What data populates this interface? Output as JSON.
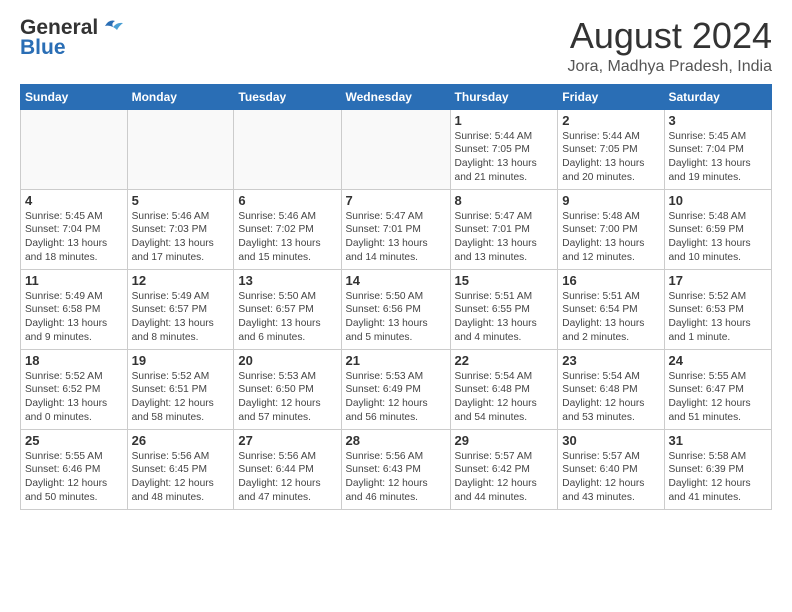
{
  "header": {
    "logo_general": "General",
    "logo_blue": "Blue",
    "month_year": "August 2024",
    "location": "Jora, Madhya Pradesh, India"
  },
  "days_of_week": [
    "Sunday",
    "Monday",
    "Tuesday",
    "Wednesday",
    "Thursday",
    "Friday",
    "Saturday"
  ],
  "weeks": [
    [
      {
        "day": "",
        "info": ""
      },
      {
        "day": "",
        "info": ""
      },
      {
        "day": "",
        "info": ""
      },
      {
        "day": "",
        "info": ""
      },
      {
        "day": "1",
        "info": "Sunrise: 5:44 AM\nSunset: 7:05 PM\nDaylight: 13 hours\nand 21 minutes."
      },
      {
        "day": "2",
        "info": "Sunrise: 5:44 AM\nSunset: 7:05 PM\nDaylight: 13 hours\nand 20 minutes."
      },
      {
        "day": "3",
        "info": "Sunrise: 5:45 AM\nSunset: 7:04 PM\nDaylight: 13 hours\nand 19 minutes."
      }
    ],
    [
      {
        "day": "4",
        "info": "Sunrise: 5:45 AM\nSunset: 7:04 PM\nDaylight: 13 hours\nand 18 minutes."
      },
      {
        "day": "5",
        "info": "Sunrise: 5:46 AM\nSunset: 7:03 PM\nDaylight: 13 hours\nand 17 minutes."
      },
      {
        "day": "6",
        "info": "Sunrise: 5:46 AM\nSunset: 7:02 PM\nDaylight: 13 hours\nand 15 minutes."
      },
      {
        "day": "7",
        "info": "Sunrise: 5:47 AM\nSunset: 7:01 PM\nDaylight: 13 hours\nand 14 minutes."
      },
      {
        "day": "8",
        "info": "Sunrise: 5:47 AM\nSunset: 7:01 PM\nDaylight: 13 hours\nand 13 minutes."
      },
      {
        "day": "9",
        "info": "Sunrise: 5:48 AM\nSunset: 7:00 PM\nDaylight: 13 hours\nand 12 minutes."
      },
      {
        "day": "10",
        "info": "Sunrise: 5:48 AM\nSunset: 6:59 PM\nDaylight: 13 hours\nand 10 minutes."
      }
    ],
    [
      {
        "day": "11",
        "info": "Sunrise: 5:49 AM\nSunset: 6:58 PM\nDaylight: 13 hours\nand 9 minutes."
      },
      {
        "day": "12",
        "info": "Sunrise: 5:49 AM\nSunset: 6:57 PM\nDaylight: 13 hours\nand 8 minutes."
      },
      {
        "day": "13",
        "info": "Sunrise: 5:50 AM\nSunset: 6:57 PM\nDaylight: 13 hours\nand 6 minutes."
      },
      {
        "day": "14",
        "info": "Sunrise: 5:50 AM\nSunset: 6:56 PM\nDaylight: 13 hours\nand 5 minutes."
      },
      {
        "day": "15",
        "info": "Sunrise: 5:51 AM\nSunset: 6:55 PM\nDaylight: 13 hours\nand 4 minutes."
      },
      {
        "day": "16",
        "info": "Sunrise: 5:51 AM\nSunset: 6:54 PM\nDaylight: 13 hours\nand 2 minutes."
      },
      {
        "day": "17",
        "info": "Sunrise: 5:52 AM\nSunset: 6:53 PM\nDaylight: 13 hours\nand 1 minute."
      }
    ],
    [
      {
        "day": "18",
        "info": "Sunrise: 5:52 AM\nSunset: 6:52 PM\nDaylight: 13 hours\nand 0 minutes."
      },
      {
        "day": "19",
        "info": "Sunrise: 5:52 AM\nSunset: 6:51 PM\nDaylight: 12 hours\nand 58 minutes."
      },
      {
        "day": "20",
        "info": "Sunrise: 5:53 AM\nSunset: 6:50 PM\nDaylight: 12 hours\nand 57 minutes."
      },
      {
        "day": "21",
        "info": "Sunrise: 5:53 AM\nSunset: 6:49 PM\nDaylight: 12 hours\nand 56 minutes."
      },
      {
        "day": "22",
        "info": "Sunrise: 5:54 AM\nSunset: 6:48 PM\nDaylight: 12 hours\nand 54 minutes."
      },
      {
        "day": "23",
        "info": "Sunrise: 5:54 AM\nSunset: 6:48 PM\nDaylight: 12 hours\nand 53 minutes."
      },
      {
        "day": "24",
        "info": "Sunrise: 5:55 AM\nSunset: 6:47 PM\nDaylight: 12 hours\nand 51 minutes."
      }
    ],
    [
      {
        "day": "25",
        "info": "Sunrise: 5:55 AM\nSunset: 6:46 PM\nDaylight: 12 hours\nand 50 minutes."
      },
      {
        "day": "26",
        "info": "Sunrise: 5:56 AM\nSunset: 6:45 PM\nDaylight: 12 hours\nand 48 minutes."
      },
      {
        "day": "27",
        "info": "Sunrise: 5:56 AM\nSunset: 6:44 PM\nDaylight: 12 hours\nand 47 minutes."
      },
      {
        "day": "28",
        "info": "Sunrise: 5:56 AM\nSunset: 6:43 PM\nDaylight: 12 hours\nand 46 minutes."
      },
      {
        "day": "29",
        "info": "Sunrise: 5:57 AM\nSunset: 6:42 PM\nDaylight: 12 hours\nand 44 minutes."
      },
      {
        "day": "30",
        "info": "Sunrise: 5:57 AM\nSunset: 6:40 PM\nDaylight: 12 hours\nand 43 minutes."
      },
      {
        "day": "31",
        "info": "Sunrise: 5:58 AM\nSunset: 6:39 PM\nDaylight: 12 hours\nand 41 minutes."
      }
    ]
  ]
}
